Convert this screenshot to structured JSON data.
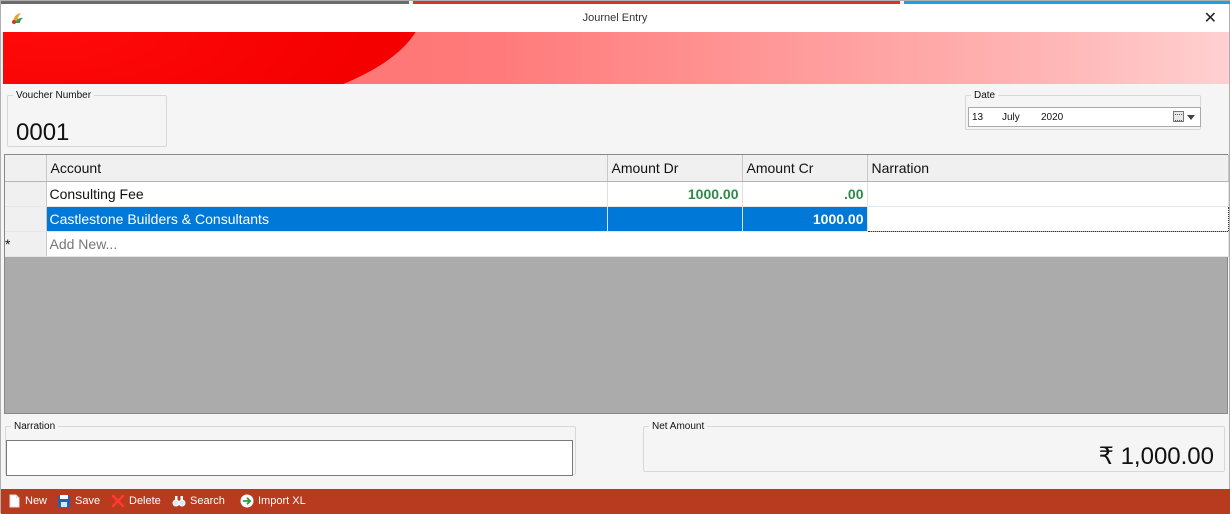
{
  "window": {
    "title": "Journel Entry",
    "close_icon": "close-icon"
  },
  "voucher": {
    "legend": "Voucher Number",
    "value": "0001"
  },
  "date": {
    "legend": "Date",
    "day": "13",
    "month": "July",
    "year": "2020"
  },
  "grid": {
    "columns": [
      "Account",
      "Amount Dr",
      "Amount Cr",
      "Narration"
    ],
    "rows": [
      {
        "account": "Consulting Fee",
        "dr": "1000.00",
        "cr": ".00",
        "narration": ""
      },
      {
        "account": "Castlestone Builders & Consultants",
        "dr": "",
        "cr": "1000.00",
        "narration": ""
      }
    ],
    "new_row_marker": "*",
    "add_new_placeholder": "Add New..."
  },
  "narration": {
    "legend": "Narration",
    "value": ""
  },
  "net_amount": {
    "legend": "Net Amount",
    "value": "₹ 1,000.00"
  },
  "toolbar": {
    "new": "New",
    "save": "Save",
    "delete": "Delete",
    "search": "Search",
    "import": "Import XL"
  },
  "colors": {
    "toolbar": "#b83a1f",
    "selection": "#0078d7",
    "amount_green": "#2e8b47"
  }
}
